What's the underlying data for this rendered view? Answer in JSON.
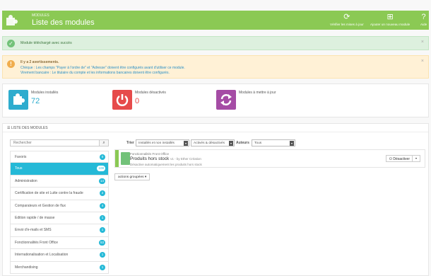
{
  "header": {
    "breadcrumb": "MODULES",
    "title": "Liste des modules",
    "actions": [
      {
        "label": "Vérifier les mises à jour",
        "icon": "refresh-icon"
      },
      {
        "label": "Ajouter un nouveau module",
        "icon": "add-module-icon"
      },
      {
        "label": "Aide",
        "icon": "help-icon"
      }
    ]
  },
  "alerts": {
    "success": "Module téléchargé avec succès",
    "warning_title": "Il y a 2 avertissements.",
    "warning_lines": [
      "Chèque : Les champs \"Payer à l'ordre de\" et \"Adresse\" doivent être configurés avant d'utiliser ce module.",
      "Virement bancaire : Le titulaire du compte et les informations bancaires doivent être configurés."
    ],
    "close_symbol": "×"
  },
  "stats": [
    {
      "label": "Modules installés",
      "value": "72",
      "color": "#2eacce",
      "icon": "puzzle-icon"
    },
    {
      "label": "Modules désactivés",
      "value": "0",
      "color": "#e64b4b",
      "icon": "power-icon"
    },
    {
      "label": "Modules à mettre à jour",
      "value": "",
      "color": "#a54ca5",
      "icon": "refresh-icon"
    }
  ],
  "module_list": {
    "heading": "LISTE DES MODULES",
    "search_placeholder": "Rechercher",
    "categories": [
      {
        "label": "Favoris",
        "count": "0"
      },
      {
        "label": "Tous",
        "count": "108",
        "active": true
      },
      {
        "label": "Administration",
        "count": "14"
      },
      {
        "label": "Certification de site et Lutte contre la fraude",
        "count": "2"
      },
      {
        "label": "Comparateurs et Gestion de flux",
        "count": "4"
      },
      {
        "label": "Edition rapide / de masse",
        "count": "1"
      },
      {
        "label": "Envoi d'e-mails et SMS",
        "count": "1"
      },
      {
        "label": "Fonctionnalités Front Office",
        "count": "53"
      },
      {
        "label": "Internationalisation et Localisation",
        "count": "1"
      },
      {
        "label": "Merchandising",
        "count": "1"
      }
    ],
    "filters": {
      "sort_label": "Trier",
      "install_filter": "Installés et non installés",
      "status_filter": "Activés & désactivés",
      "authors_label": "Auteurs",
      "authors_value": "Tous"
    },
    "module": {
      "category": "Fonctionnalités Front Office",
      "name": "Produits hors stock",
      "version": "v1 - by Ether Création",
      "description": "Désactive automatiquement les produits hors stock",
      "action": "Désactiver"
    },
    "bulk_actions": "actions groupées"
  },
  "colors": {
    "header_green": "#8bc954",
    "accent_blue": "#25b9d7"
  }
}
